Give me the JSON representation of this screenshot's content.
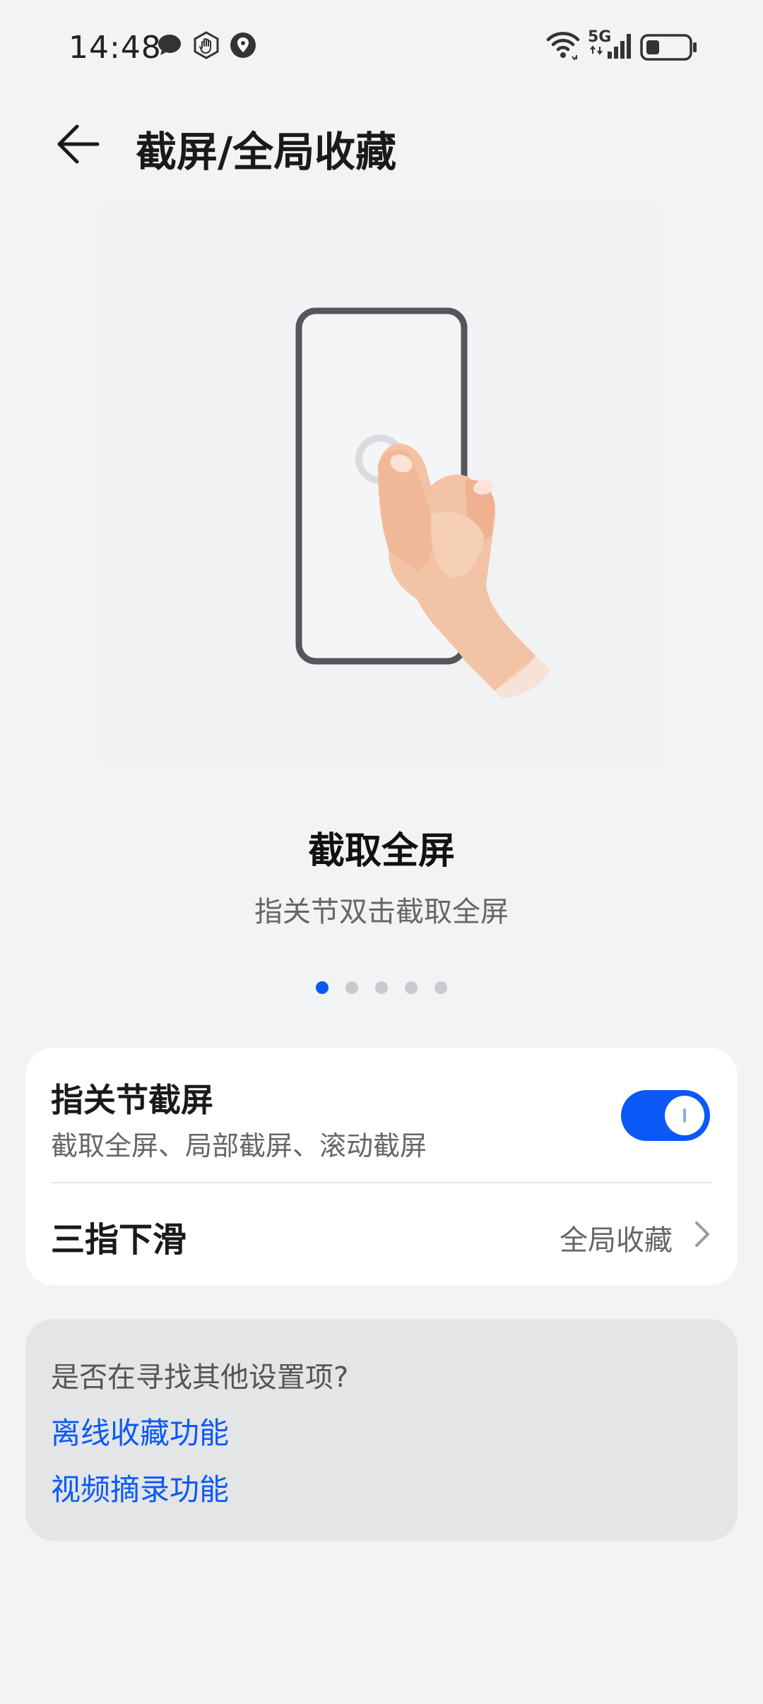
{
  "status_bar": {
    "time": "14:48",
    "left_icons": [
      "message-icon",
      "hand-icon",
      "location-icon"
    ],
    "right_icons": [
      "wifi-icon",
      "signal-5g-icon",
      "battery-icon"
    ],
    "network_label": "5G"
  },
  "header": {
    "title": "截屏/全局收藏"
  },
  "carousel": {
    "title": "截取全屏",
    "description": "指关节双击截取全屏",
    "pages": 5,
    "active_index": 0
  },
  "settings_card": {
    "knuckle": {
      "title": "指关节截屏",
      "subtitle": "截取全屏、局部截屏、滚动截屏",
      "enabled": true
    },
    "three_finger": {
      "title": "三指下滑",
      "value": "全局收藏"
    }
  },
  "suggestions": {
    "question": "是否在寻找其他设置项?",
    "links": [
      "离线收藏功能",
      "视频摘录功能"
    ]
  },
  "colors": {
    "accent": "#0a59f7",
    "background": "#f1f3f5",
    "card": "#ffffff",
    "suggest_bg": "#e4e5e7"
  }
}
